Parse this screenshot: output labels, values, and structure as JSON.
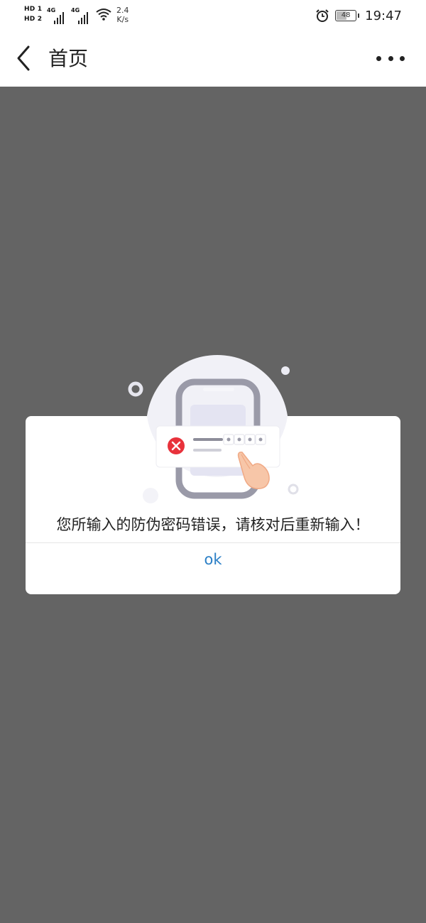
{
  "status_bar": {
    "sim1": "HD 1",
    "sim2": "HD 2",
    "net1": "4G",
    "net2": "4G",
    "speed_value": "2.4",
    "speed_unit": "K/s",
    "battery": "48",
    "battery_level": 0.48,
    "time": "19:47",
    "icons": [
      "signal-icon",
      "wifi-icon",
      "alarm-icon",
      "battery-icon"
    ]
  },
  "navbar": {
    "back_icon": "chevron-left-icon",
    "title": "首页",
    "more_icon": "more-dots-icon"
  },
  "dialog": {
    "illustration": "phone-password-error-illustration",
    "message": "您所输入的防伪密码错误，请核对后重新输入！",
    "ok_label": "ok"
  },
  "colors": {
    "overlay": "#646464",
    "ok_text": "#2b7fc6",
    "error_red": "#e8323b",
    "illustration_bg": "#f1f1f7",
    "phone_frame": "#9a9aa8"
  }
}
